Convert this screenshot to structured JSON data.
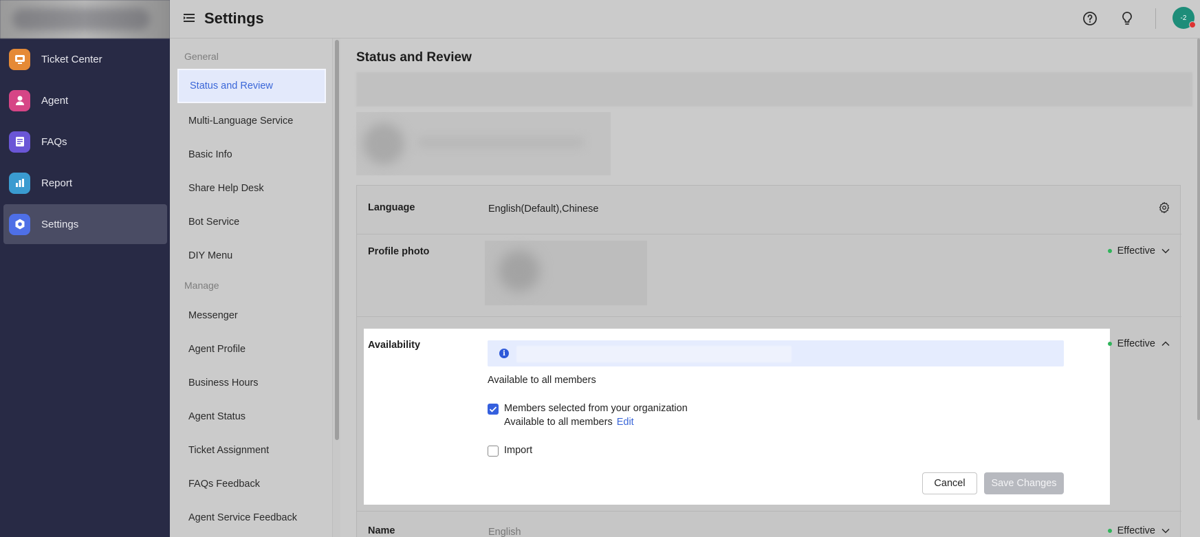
{
  "app_nav": {
    "items": [
      {
        "label": "Ticket Center",
        "icon": "ticket-center-icon",
        "color": "#e58a36"
      },
      {
        "label": "Agent",
        "icon": "agent-icon",
        "color": "#d64586"
      },
      {
        "label": "FAQs",
        "icon": "faqs-icon",
        "color": "#6a56d6"
      },
      {
        "label": "Report",
        "icon": "report-icon",
        "color": "#3a9bd0"
      },
      {
        "label": "Settings",
        "icon": "settings-icon",
        "color": "#4e6fe6"
      }
    ],
    "active_index": 4
  },
  "header": {
    "title": "Settings",
    "avatar_text": "-2"
  },
  "submenu": {
    "groups": [
      {
        "title": "General",
        "items": [
          "Status and Review",
          "Multi-Language Service",
          "Basic Info",
          "Share Help Desk",
          "Bot Service",
          "DIY Menu"
        ]
      },
      {
        "title": "Manage",
        "items": [
          "Messenger",
          "Agent Profile",
          "Business Hours",
          "Agent Status",
          "Ticket Assignment",
          "FAQs Feedback",
          "Agent Service Feedback"
        ]
      }
    ],
    "active": "Status and Review"
  },
  "main": {
    "section_title": "Status and Review",
    "rows": {
      "language": {
        "label": "Language",
        "value": "English(Default),Chinese"
      },
      "profile_photo": {
        "label": "Profile photo",
        "status": "Effective"
      },
      "availability": {
        "label": "Availability",
        "status": "Effective",
        "available_all": "Available to all members",
        "option_members": {
          "label": "Members selected from your organization",
          "checked": true,
          "sub": "Available to all members",
          "edit": "Edit"
        },
        "option_import": {
          "label": "Import",
          "checked": false
        },
        "cancel": "Cancel",
        "save": "Save Changes"
      },
      "name": {
        "label": "Name",
        "value": "English",
        "status": "Effective"
      }
    }
  },
  "colors": {
    "accent": "#3a66d8",
    "effective_dot": "#2fb45a",
    "nav_bg": "#282a45"
  }
}
